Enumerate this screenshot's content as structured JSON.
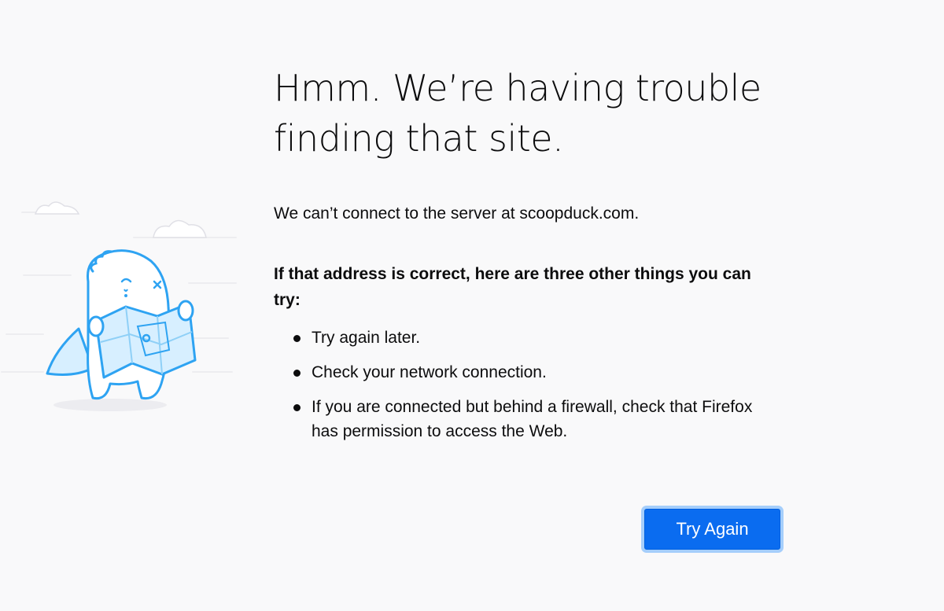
{
  "page": {
    "title": "Hmm. We’re having trouble finding that site.",
    "description": "We can’t connect to the server at scoopduck.com.",
    "tips_heading": "If that address is correct, here are three other things you can try:",
    "tips": [
      "Try again later.",
      "Check your network connection.",
      "If you are connected but behind a firewall, check that Firefox has permission to access the Web."
    ],
    "try_again_label": "Try Again"
  },
  "colors": {
    "background": "#f9f9fa",
    "button": "#0a6cf0",
    "button_focus_ring": "#a5cefb",
    "illustration_stroke": "#2ea3f2",
    "illustration_fill": "#d7efff"
  },
  "icons": {
    "illustration": "lost-dino-with-map-illustration",
    "bullet": "bullet-dot"
  }
}
